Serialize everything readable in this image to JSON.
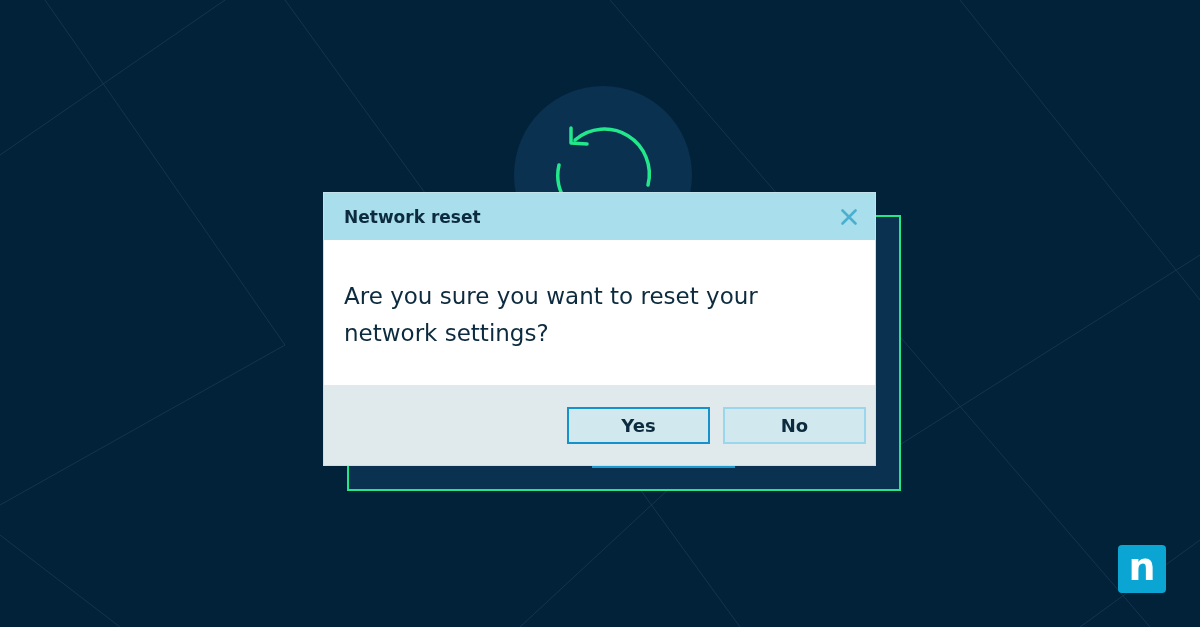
{
  "dialog": {
    "title": "Network reset",
    "message": "Are you sure you want to reset your network settings?",
    "buttons": [
      {
        "label": "Yes",
        "default": true
      },
      {
        "label": "No",
        "default": false
      }
    ]
  },
  "logo": {
    "text": "n"
  }
}
